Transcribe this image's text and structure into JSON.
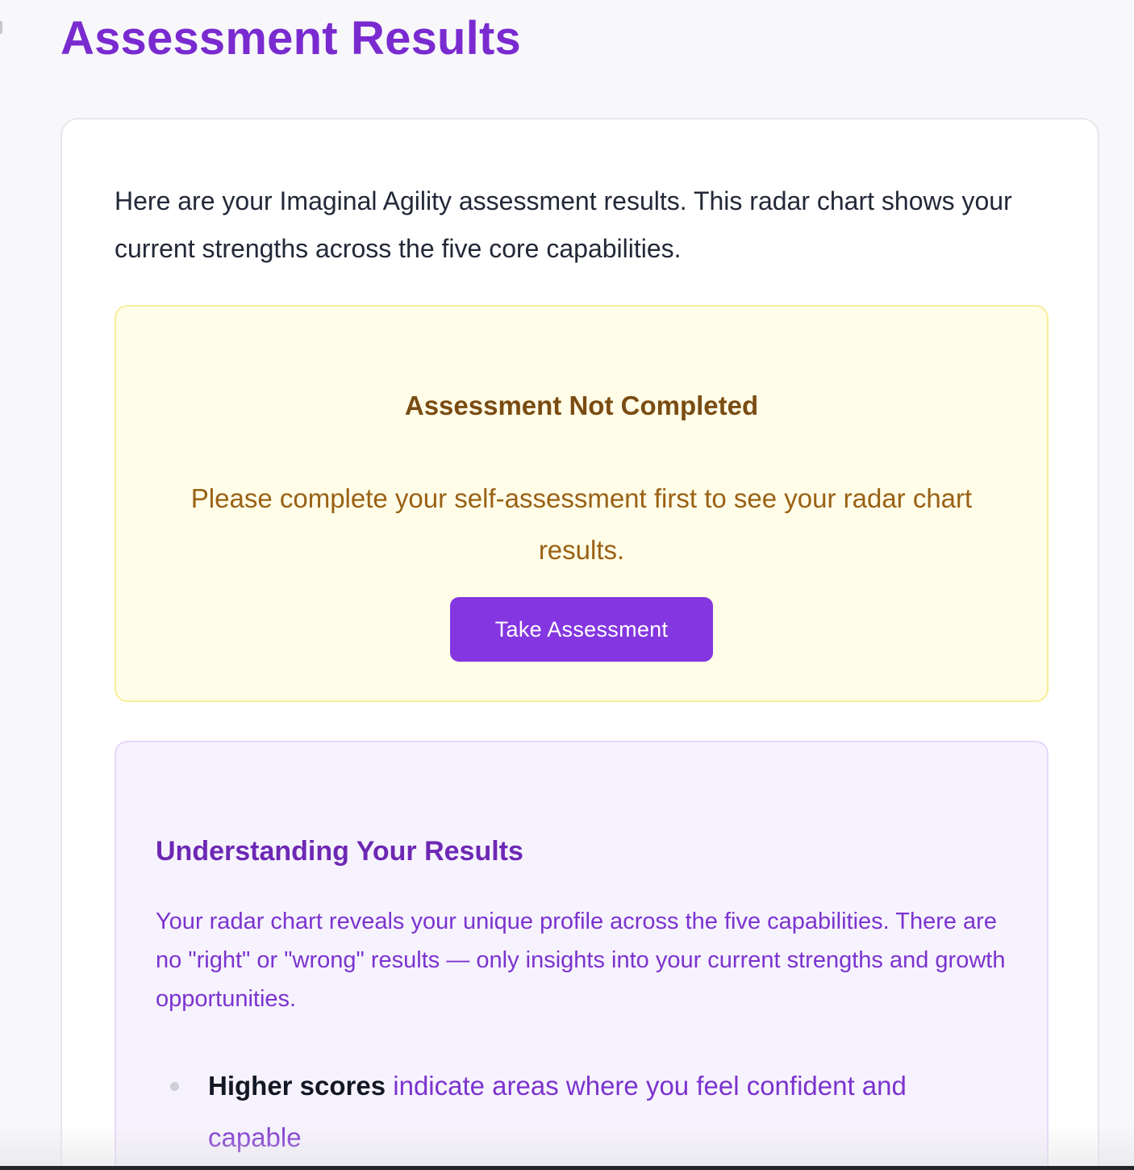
{
  "page": {
    "title": "Assessment Results"
  },
  "intro": {
    "text": "Here are your Imaginal Agility assessment results. This radar chart shows your current strengths across the five core capabilities."
  },
  "notice": {
    "title": "Assessment Not Completed",
    "message": "Please complete your self-assessment first to see your radar chart results.",
    "button_label": "Take Assessment"
  },
  "info": {
    "title": "Understanding Your Results",
    "text": "Your radar chart reveals your unique profile across the five capabilities. There are no \"right\" or \"wrong\" results — only insights into your current strengths and growth opportunities.",
    "items": [
      {
        "lead": "Higher scores",
        "text": " indicate areas where you feel confident and capable"
      }
    ]
  },
  "colors": {
    "accent": "#7a2bd0",
    "button": "#8436e0",
    "notice_bg": "#fffde8",
    "notice_border": "#f7ee9a",
    "notice_title": "#7a4c12",
    "notice_text": "#9a6114",
    "info_bg": "#f7f3fe",
    "info_title": "#6d28b4",
    "info_text": "#7b33cf"
  }
}
